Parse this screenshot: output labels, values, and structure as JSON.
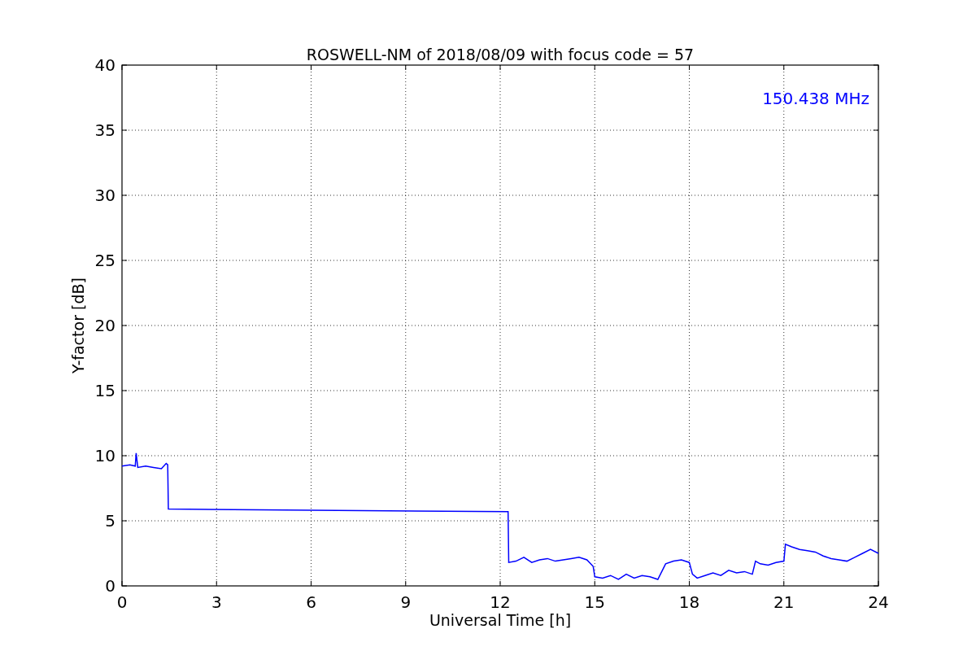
{
  "chart_data": {
    "type": "line",
    "title": "ROSWELL-NM of 2018/08/09 with focus code = 57",
    "xlabel": "Universal Time [h]",
    "ylabel": "Y-factor [dB]",
    "x": [
      0,
      0.25,
      0.42,
      0.45,
      0.5,
      0.75,
      1.0,
      1.25,
      1.4,
      1.45,
      1.47,
      12.25,
      12.27,
      12.5,
      12.75,
      13,
      13.25,
      13.5,
      13.75,
      14,
      14.25,
      14.5,
      14.75,
      14.95,
      15.0,
      15.25,
      15.5,
      15.75,
      16,
      16.25,
      16.5,
      16.75,
      17,
      17.25,
      17.5,
      17.75,
      18,
      18.1,
      18.25,
      18.5,
      18.75,
      19,
      19.25,
      19.5,
      19.75,
      20,
      20.1,
      20.25,
      20.5,
      20.75,
      21,
      21.05,
      21.25,
      21.5,
      21.75,
      22,
      22.25,
      22.5,
      22.75,
      23,
      23.25,
      23.5,
      23.75,
      24
    ],
    "series": [
      {
        "name": "150.438 MHz",
        "color": "#0000ff",
        "values": [
          9.2,
          9.3,
          9.2,
          10.2,
          9.1,
          9.2,
          9.1,
          9.0,
          9.4,
          9.3,
          5.9,
          5.7,
          1.8,
          1.9,
          2.2,
          1.8,
          2.0,
          2.1,
          1.9,
          2.0,
          2.1,
          2.2,
          2.0,
          1.5,
          0.7,
          0.6,
          0.8,
          0.5,
          0.9,
          0.6,
          0.8,
          0.7,
          0.5,
          1.7,
          1.9,
          2.0,
          1.8,
          0.9,
          0.6,
          0.8,
          1.0,
          0.8,
          1.2,
          1.0,
          1.1,
          0.9,
          1.9,
          1.7,
          1.6,
          1.8,
          1.9,
          3.2,
          3.0,
          2.8,
          2.7,
          2.6,
          2.3,
          2.1,
          2.0,
          1.9,
          2.2,
          2.5,
          2.8,
          2.5
        ]
      }
    ],
    "xlim": [
      0,
      24
    ],
    "ylim": [
      0,
      40
    ],
    "xticks": [
      0,
      3,
      6,
      9,
      12,
      15,
      18,
      21,
      24
    ],
    "yticks": [
      0,
      5,
      10,
      15,
      20,
      25,
      30,
      35,
      40
    ],
    "grid": true
  }
}
